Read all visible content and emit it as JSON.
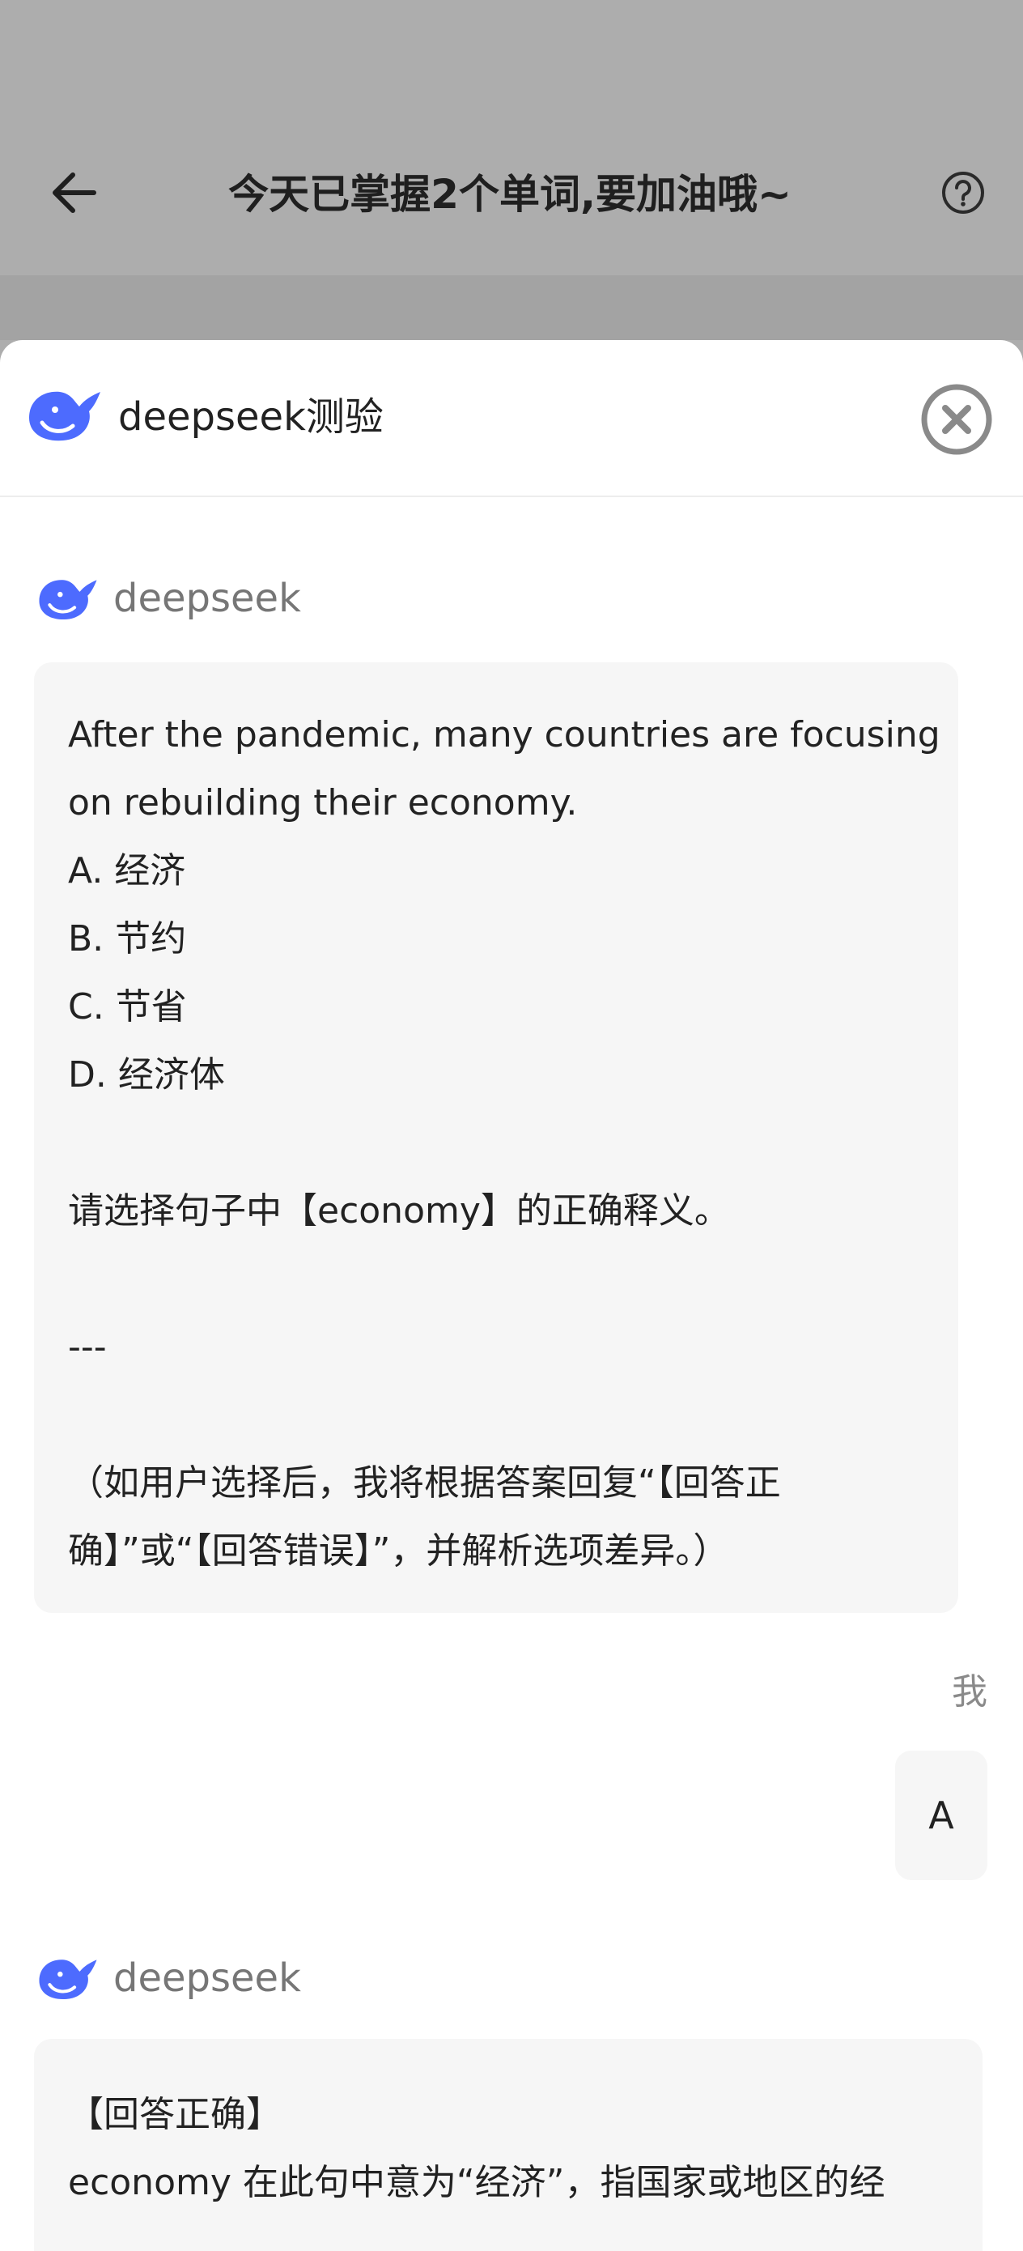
{
  "header": {
    "title": "今天已掌握2个单词,要加油哦~",
    "back_icon": "arrow-left-icon",
    "help_icon": "question-circle-icon"
  },
  "sheet": {
    "title": "deepseek测验",
    "logo_icon": "deepseek-whale-icon",
    "close_icon": "close-circle-icon"
  },
  "messages": {
    "bot_name": "deepseek",
    "question": {
      "lines": [
        "After the pandemic, many countries are focusing",
        "on rebuilding their economy.",
        "A. 经济",
        "B. 节约",
        "C. 节省",
        "D. 经济体",
        "",
        "请选择句子中【economy】的正确释义。",
        "",
        "---",
        "",
        "（如用户选择后，我将根据答案回复“【回答正",
        "确】”或“【回答错误】”，并解析选项差异。）"
      ]
    },
    "user_label": "我",
    "user_answer": "A",
    "reply": {
      "lines": [
        "【回答正确】",
        "economy 在此句中意为“经济”，指国家或地区的经"
      ]
    }
  },
  "colors": {
    "brand": "#4d6bfe",
    "overlay": "#adadad",
    "bubble": "#f6f6f6"
  }
}
